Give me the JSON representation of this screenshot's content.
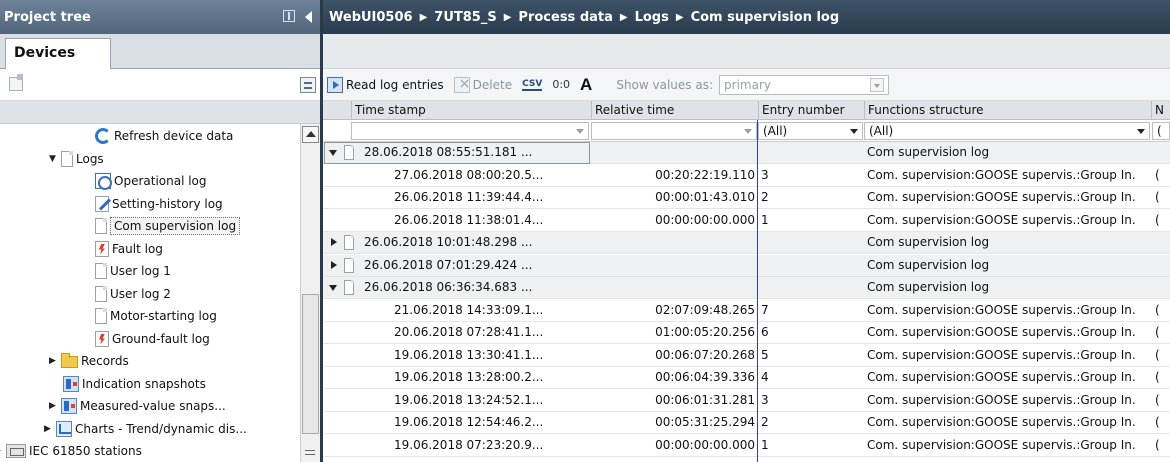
{
  "left_panel": {
    "title": "Project tree",
    "tab": "Devices",
    "tree": [
      {
        "label": "Refresh device data",
        "icon": "refresh-icon",
        "indent": 2,
        "arrow": ""
      },
      {
        "label": "Logs",
        "icon": "page-icon",
        "indent": 1,
        "arrow": "open"
      },
      {
        "label": "Operational log",
        "icon": "clock-icon",
        "indent": 2,
        "arrow": ""
      },
      {
        "label": "Setting-history log",
        "icon": "pen-icon",
        "indent": 2,
        "arrow": ""
      },
      {
        "label": "Com supervision log",
        "icon": "page-icon",
        "indent": 2,
        "arrow": "",
        "selected": true
      },
      {
        "label": "Fault log",
        "icon": "fault-icon",
        "indent": 2,
        "arrow": ""
      },
      {
        "label": "User log 1",
        "icon": "page-icon",
        "indent": 2,
        "arrow": ""
      },
      {
        "label": "User log 2",
        "icon": "page-icon",
        "indent": 2,
        "arrow": ""
      },
      {
        "label": "Motor-starting log",
        "icon": "page-icon",
        "indent": 2,
        "arrow": ""
      },
      {
        "label": "Ground-fault log",
        "icon": "fault-icon",
        "indent": 2,
        "arrow": ""
      },
      {
        "label": "Records",
        "icon": "folder-icon",
        "indent": 1,
        "arrow": "closed"
      },
      {
        "label": "Indication snapshots",
        "icon": "snapshot-icon",
        "indent": 1,
        "arrow": ""
      },
      {
        "label": "Measured-value snaps...",
        "icon": "snapshot-icon",
        "indent": 1,
        "arrow": "closed"
      },
      {
        "label": "Charts - Trend/dynamic dis...",
        "icon": "chart-icon",
        "indent": 0.5,
        "arrow": "closed"
      },
      {
        "label": "IEC 61850 stations",
        "icon": "station-icon",
        "indent": 0,
        "arrow": "closed"
      }
    ]
  },
  "breadcrumb": [
    "WebUI0506",
    "7UT85_S",
    "Process data",
    "Logs",
    "Com supervision log"
  ],
  "toolbar": {
    "read_label": "Read log entries",
    "delete_label": "Delete",
    "csv_label": "CSV",
    "hex_label": "0:0",
    "font_label": "A",
    "show_values_label": "Show values as:",
    "show_values_value": "primary"
  },
  "grid": {
    "columns": [
      "Time stamp",
      "Relative time",
      "Entry number",
      "Functions structure",
      "N"
    ],
    "filters": {
      "entry_number": "(All)",
      "functions_structure": "(All)"
    },
    "rows": [
      {
        "type": "group",
        "open": true,
        "time": "28.06.2018 08:55:51.181 ...",
        "rel": "",
        "entry": "",
        "func": "Com supervision log",
        "n": ""
      },
      {
        "type": "item",
        "time": "27.06.2018 08:00:20.5...",
        "rel": "00:20:22:19.110",
        "entry": "3",
        "func": "Com. supervision:GOOSE supervis.:Group In.",
        "n": "("
      },
      {
        "type": "item",
        "time": "26.06.2018 11:39:44.4...",
        "rel": "00:00:01:43.010",
        "entry": "2",
        "func": "Com. supervision:GOOSE supervis.:Group In.",
        "n": "("
      },
      {
        "type": "item",
        "time": "26.06.2018 11:38:01.4...",
        "rel": "00:00:00:00.000",
        "entry": "1",
        "func": "Com. supervision:GOOSE supervis.:Group In.",
        "n": "("
      },
      {
        "type": "group",
        "open": false,
        "time": "26.06.2018 10:01:48.298 ...",
        "rel": "",
        "entry": "",
        "func": "Com supervision log",
        "n": ""
      },
      {
        "type": "group",
        "open": false,
        "time": "26.06.2018 07:01:29.424 ...",
        "rel": "",
        "entry": "",
        "func": "Com supervision log",
        "n": ""
      },
      {
        "type": "group",
        "open": true,
        "time": "26.06.2018 06:36:34.683 ...",
        "rel": "",
        "entry": "",
        "func": "Com supervision log",
        "n": ""
      },
      {
        "type": "item",
        "time": "21.06.2018 14:33:09.1...",
        "rel": "02:07:09:48.265",
        "entry": "7",
        "func": "Com. supervision:GOOSE supervis.:Group In.",
        "n": "("
      },
      {
        "type": "item",
        "time": "20.06.2018 07:28:41.1...",
        "rel": "01:00:05:20.256",
        "entry": "6",
        "func": "Com. supervision:GOOSE supervis.:Group In.",
        "n": "("
      },
      {
        "type": "item",
        "time": "19.06.2018 13:30:41.1...",
        "rel": "00:06:07:20.268",
        "entry": "5",
        "func": "Com. supervision:GOOSE supervis.:Group In.",
        "n": "("
      },
      {
        "type": "item",
        "time": "19.06.2018 13:28:00.2...",
        "rel": "00:06:04:39.336",
        "entry": "4",
        "func": "Com. supervision:GOOSE supervis.:Group In.",
        "n": "("
      },
      {
        "type": "item",
        "time": "19.06.2018 13:24:52.1...",
        "rel": "00:06:01:31.281",
        "entry": "3",
        "func": "Com. supervision:GOOSE supervis.:Group In.",
        "n": "("
      },
      {
        "type": "item",
        "time": "19.06.2018 12:54:46.2...",
        "rel": "00:05:31:25.294",
        "entry": "2",
        "func": "Com. supervision:GOOSE supervis.:Group In.",
        "n": "("
      },
      {
        "type": "item",
        "time": "19.06.2018 07:23:20.9...",
        "rel": "00:00:00:00.000",
        "entry": "1",
        "func": "Com. supervision:GOOSE supervis.:Group In.",
        "n": "("
      }
    ]
  }
}
